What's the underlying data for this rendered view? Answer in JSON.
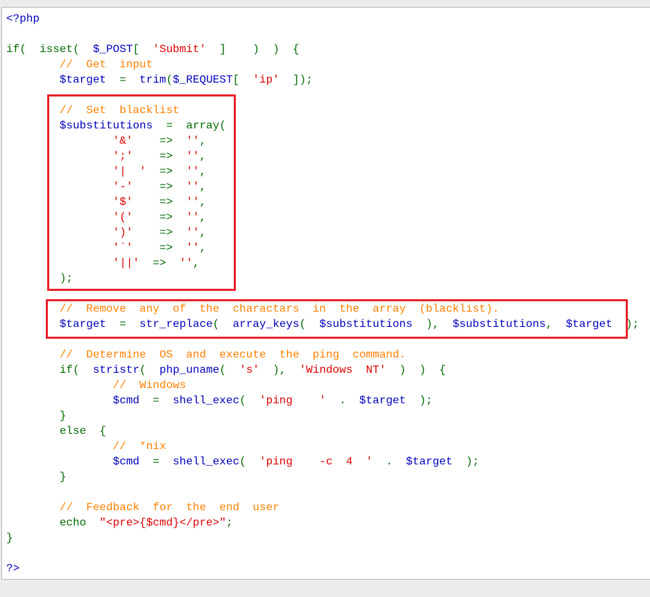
{
  "code": {
    "lines": [
      [
        {
          "t": "<?php",
          "c": "php"
        }
      ],
      [],
      [
        {
          "t": "if(  isset(  ",
          "c": "default"
        },
        {
          "t": "$_POST",
          "c": "var"
        },
        {
          "t": "[  ",
          "c": "default"
        },
        {
          "t": "'Submit'",
          "c": "string"
        },
        {
          "t": "  ]    )  )  {",
          "c": "default"
        }
      ],
      [
        {
          "t": "        ",
          "c": "default"
        },
        {
          "t": "//  Get  input",
          "c": "comment"
        }
      ],
      [
        {
          "t": "        ",
          "c": "default"
        },
        {
          "t": "$target",
          "c": "var"
        },
        {
          "t": "  =  ",
          "c": "default"
        },
        {
          "t": "trim",
          "c": "fn"
        },
        {
          "t": "(",
          "c": "default"
        },
        {
          "t": "$_REQUEST",
          "c": "var"
        },
        {
          "t": "[  ",
          "c": "default"
        },
        {
          "t": "'ip'",
          "c": "string"
        },
        {
          "t": "  ]);",
          "c": "default"
        }
      ],
      [],
      [
        {
          "t": "        ",
          "c": "default"
        },
        {
          "t": "//  Set  blacklist",
          "c": "comment"
        }
      ],
      [
        {
          "t": "        ",
          "c": "default"
        },
        {
          "t": "$substitutions",
          "c": "var"
        },
        {
          "t": "  =  ",
          "c": "default"
        },
        {
          "t": "array(",
          "c": "default"
        }
      ],
      [
        {
          "t": "                ",
          "c": "default"
        },
        {
          "t": "'&'",
          "c": "string"
        },
        {
          "t": "    =>  ",
          "c": "default"
        },
        {
          "t": "''",
          "c": "string"
        },
        {
          "t": ",",
          "c": "default"
        }
      ],
      [
        {
          "t": "                ",
          "c": "default"
        },
        {
          "t": "';'",
          "c": "string"
        },
        {
          "t": "    =>  ",
          "c": "default"
        },
        {
          "t": "''",
          "c": "string"
        },
        {
          "t": ",",
          "c": "default"
        }
      ],
      [
        {
          "t": "                ",
          "c": "default"
        },
        {
          "t": "'|  '",
          "c": "string"
        },
        {
          "t": "  =>  ",
          "c": "default"
        },
        {
          "t": "''",
          "c": "string"
        },
        {
          "t": ",",
          "c": "default"
        }
      ],
      [
        {
          "t": "                ",
          "c": "default"
        },
        {
          "t": "'-'",
          "c": "string"
        },
        {
          "t": "    =>  ",
          "c": "default"
        },
        {
          "t": "''",
          "c": "string"
        },
        {
          "t": ",",
          "c": "default"
        }
      ],
      [
        {
          "t": "                ",
          "c": "default"
        },
        {
          "t": "'$'",
          "c": "string"
        },
        {
          "t": "    =>  ",
          "c": "default"
        },
        {
          "t": "''",
          "c": "string"
        },
        {
          "t": ",",
          "c": "default"
        }
      ],
      [
        {
          "t": "                ",
          "c": "default"
        },
        {
          "t": "'('",
          "c": "string"
        },
        {
          "t": "    =>  ",
          "c": "default"
        },
        {
          "t": "''",
          "c": "string"
        },
        {
          "t": ",",
          "c": "default"
        }
      ],
      [
        {
          "t": "                ",
          "c": "default"
        },
        {
          "t": "')'",
          "c": "string"
        },
        {
          "t": "    =>  ",
          "c": "default"
        },
        {
          "t": "''",
          "c": "string"
        },
        {
          "t": ",",
          "c": "default"
        }
      ],
      [
        {
          "t": "                ",
          "c": "default"
        },
        {
          "t": "'`'",
          "c": "string"
        },
        {
          "t": "    =>  ",
          "c": "default"
        },
        {
          "t": "''",
          "c": "string"
        },
        {
          "t": ",",
          "c": "default"
        }
      ],
      [
        {
          "t": "                ",
          "c": "default"
        },
        {
          "t": "'||'",
          "c": "string"
        },
        {
          "t": "  =>  ",
          "c": "default"
        },
        {
          "t": "''",
          "c": "string"
        },
        {
          "t": ",",
          "c": "default"
        }
      ],
      [
        {
          "t": "        );",
          "c": "default"
        }
      ],
      [],
      [
        {
          "t": "        ",
          "c": "default"
        },
        {
          "t": "//  Remove  any  of  the  charactars  in  the  array  (blacklist).",
          "c": "comment"
        }
      ],
      [
        {
          "t": "        ",
          "c": "default"
        },
        {
          "t": "$target",
          "c": "var"
        },
        {
          "t": "  =  ",
          "c": "default"
        },
        {
          "t": "str_replace",
          "c": "fn"
        },
        {
          "t": "(  ",
          "c": "default"
        },
        {
          "t": "array_keys",
          "c": "fn"
        },
        {
          "t": "(  ",
          "c": "default"
        },
        {
          "t": "$substitutions",
          "c": "var"
        },
        {
          "t": "  ),  ",
          "c": "default"
        },
        {
          "t": "$substitutions",
          "c": "var"
        },
        {
          "t": ",  ",
          "c": "default"
        },
        {
          "t": "$target",
          "c": "var"
        },
        {
          "t": "  );",
          "c": "default"
        }
      ],
      [],
      [
        {
          "t": "        ",
          "c": "default"
        },
        {
          "t": "//  Determine  OS  and  execute  the  ping  command.",
          "c": "comment"
        }
      ],
      [
        {
          "t": "        if(  ",
          "c": "default"
        },
        {
          "t": "stristr",
          "c": "fn"
        },
        {
          "t": "(  ",
          "c": "default"
        },
        {
          "t": "php_uname",
          "c": "fn"
        },
        {
          "t": "(  ",
          "c": "default"
        },
        {
          "t": "'s'",
          "c": "string"
        },
        {
          "t": "  ),  ",
          "c": "default"
        },
        {
          "t": "'Windows  NT'",
          "c": "string"
        },
        {
          "t": "  )  )  {",
          "c": "default"
        }
      ],
      [
        {
          "t": "                ",
          "c": "default"
        },
        {
          "t": "//  Windows",
          "c": "comment"
        }
      ],
      [
        {
          "t": "                ",
          "c": "default"
        },
        {
          "t": "$cmd",
          "c": "var"
        },
        {
          "t": "  =  ",
          "c": "default"
        },
        {
          "t": "shell_exec",
          "c": "fn"
        },
        {
          "t": "(  ",
          "c": "default"
        },
        {
          "t": "'ping    '",
          "c": "string"
        },
        {
          "t": "  .  ",
          "c": "default"
        },
        {
          "t": "$target",
          "c": "var"
        },
        {
          "t": "  );",
          "c": "default"
        }
      ],
      [
        {
          "t": "        }",
          "c": "default"
        }
      ],
      [
        {
          "t": "        else  {",
          "c": "default"
        }
      ],
      [
        {
          "t": "                ",
          "c": "default"
        },
        {
          "t": "//  *nix",
          "c": "comment"
        }
      ],
      [
        {
          "t": "                ",
          "c": "default"
        },
        {
          "t": "$cmd",
          "c": "var"
        },
        {
          "t": "  =  ",
          "c": "default"
        },
        {
          "t": "shell_exec",
          "c": "fn"
        },
        {
          "t": "(  ",
          "c": "default"
        },
        {
          "t": "'ping    -c  4  '",
          "c": "string"
        },
        {
          "t": "  .  ",
          "c": "default"
        },
        {
          "t": "$target",
          "c": "var"
        },
        {
          "t": "  );",
          "c": "default"
        }
      ],
      [
        {
          "t": "        }",
          "c": "default"
        }
      ],
      [],
      [
        {
          "t": "        ",
          "c": "default"
        },
        {
          "t": "//  Feedback  for  the  end  user",
          "c": "comment"
        }
      ],
      [
        {
          "t": "        echo  ",
          "c": "default"
        },
        {
          "t": "\"<pre>{$cmd}</pre>\"",
          "c": "string"
        },
        {
          "t": ";",
          "c": "default"
        }
      ],
      [
        {
          "t": "}",
          "c": "default"
        }
      ],
      [],
      [
        {
          "t": "?>",
          "c": "php"
        }
      ]
    ]
  },
  "colors": {
    "default": "#006a00",
    "function": "#0000bb",
    "variable": "#0000bb",
    "string": "#dd0000",
    "comment": "#ff8000",
    "highlight_border": "#e8202a"
  }
}
